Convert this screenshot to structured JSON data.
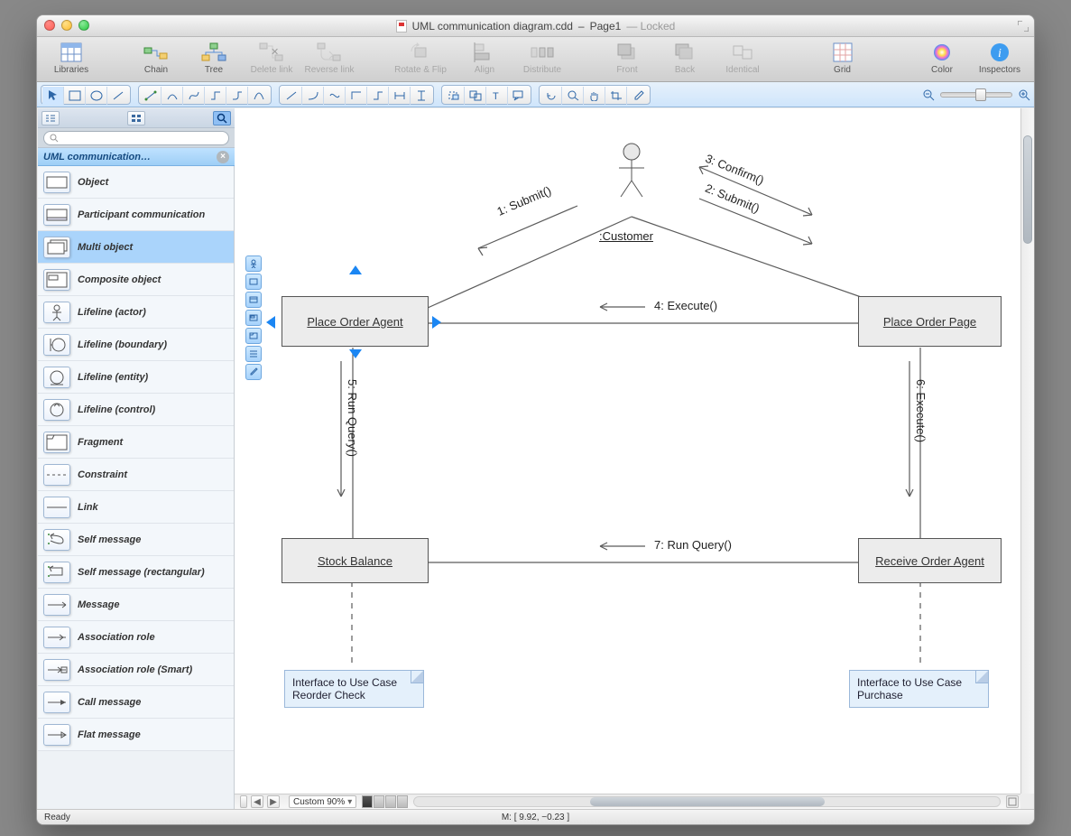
{
  "title": {
    "filename": "UML communication diagram.cdd",
    "page": "Page1",
    "status": "Locked"
  },
  "toolbar": {
    "libraries": "Libraries",
    "chain": "Chain",
    "tree": "Tree",
    "delete_link": "Delete link",
    "reverse_link": "Reverse link",
    "rotate_flip": "Rotate & Flip",
    "align": "Align",
    "distribute": "Distribute",
    "front": "Front",
    "back": "Back",
    "identical": "Identical",
    "grid": "Grid",
    "color": "Color",
    "inspectors": "Inspectors"
  },
  "library": {
    "title": "UML communication…",
    "search_placeholder": "",
    "items": [
      "Object",
      "Participant communication",
      "Multi object",
      "Composite object",
      "Lifeline (actor)",
      "Lifeline (boundary)",
      "Lifeline (entity)",
      "Lifeline (control)",
      "Fragment",
      "Constraint",
      "Link",
      "Self message",
      "Self message (rectangular)",
      "Message",
      "Association role",
      "Association role (Smart)",
      "Call message",
      "Flat message"
    ],
    "selected_index": 2
  },
  "diagram": {
    "actor": ":Customer",
    "nodes": {
      "place_order_agent": "Place Order Agent",
      "place_order_page": "Place Order Page",
      "stock_balance": "Stock Balance",
      "receive_order_agent": "Receive Order Agent"
    },
    "messages": {
      "m1": "1: Submit()",
      "m2": "2: Submit()",
      "m3": "3: Confirm()",
      "m4": "4: Execute()",
      "m5": "5: Run Query()",
      "m6": "6: Execute()",
      "m7": "7: Run Query()"
    },
    "notes": {
      "left": "Interface to Use Case Reorder Check",
      "right": "Interface to Use Case Purchase"
    }
  },
  "footer": {
    "zoom": "Custom 90%",
    "ready": "Ready",
    "mouse": "M: [ 9.92, −0.23 ]"
  }
}
